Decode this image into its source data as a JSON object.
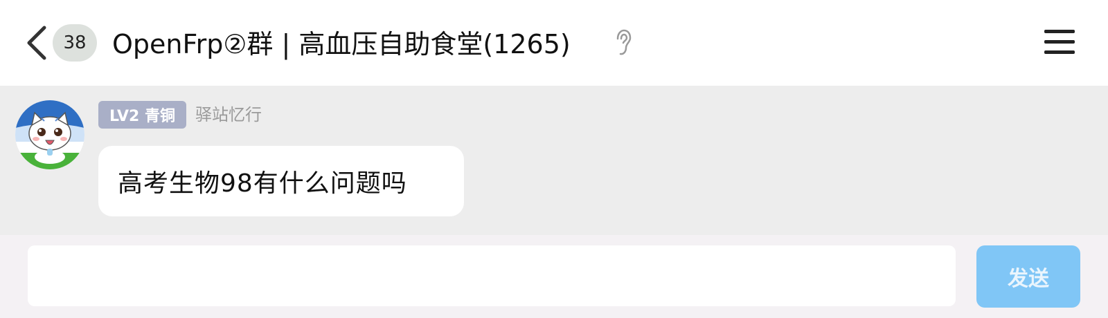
{
  "header": {
    "unread_count": "38",
    "title": "OpenFrp②群 | 高血压自助食堂(1265)"
  },
  "message": {
    "level_badge": "LV2 青铜",
    "sender_name": "驿站忆行",
    "text": "高考生物98有什么问题吗"
  },
  "composer": {
    "input_value": "",
    "send_label": "发送"
  },
  "colors": {
    "header_bg": "#ffffff",
    "chat_bg": "#ededed",
    "composer_bg": "#f4f1f4",
    "badge_bg": "#dde1dd",
    "level_badge_bg": "#a9afc7",
    "send_button_bg": "#80c6f6"
  },
  "icons": [
    "back-chevron-icon",
    "ear-icon",
    "menu-icon"
  ]
}
